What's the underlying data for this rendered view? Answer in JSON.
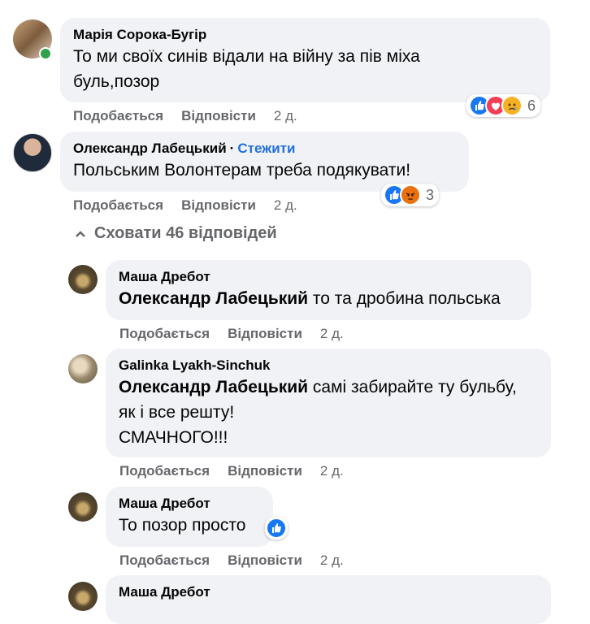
{
  "comments": [
    {
      "author": "Марія Сорока-Бугір",
      "lines": [
        "То ми своїх синів відали на війну за пів міха",
        "буль,позор"
      ],
      "actions": {
        "like": "Подобається",
        "reply": "Відповісти",
        "time": "2 д."
      },
      "reaction_count": "6",
      "reactions": [
        "like-icon",
        "love-icon",
        "sad-icon"
      ]
    },
    {
      "author": "Олександр Лабецький",
      "follow": "Стежити",
      "lines": [
        "Польським Волонтерам треба подякувати!"
      ],
      "actions": {
        "like": "Подобається",
        "reply": "Відповісти",
        "time": "2 д."
      },
      "reaction_count": "3",
      "reactions": [
        "like-icon",
        "angry-icon"
      ]
    }
  ],
  "toggle_label": "Сховати 46 відповідей",
  "replies": [
    {
      "author": "Маша Дребот",
      "mention": "Олександр Лабецький",
      "lines": [
        " то та дробина польська"
      ],
      "actions": {
        "like": "Подобається",
        "reply": "Відповісти",
        "time": "2 д."
      }
    },
    {
      "author": "Galinka Lyakh-Sinchuk",
      "mention": "Олександр Лабецький",
      "lines": [
        " самі забирайте ту бульбу,",
        "як і все решту!",
        "СМАЧНОГО!!!"
      ],
      "actions": {
        "like": "Подобається",
        "reply": "Відповісти",
        "time": "2 д."
      }
    },
    {
      "author": "Маша Дребот",
      "lines": [
        "То позор просто"
      ],
      "actions": {
        "like": "Подобається",
        "reply": "Відповісти",
        "time": "2 д."
      },
      "reactions": [
        "like-icon"
      ]
    },
    {
      "author": "Маша Дребот"
    }
  ],
  "colors": {
    "bubble": "#f0f2f5",
    "muted": "#65676b",
    "link": "#216fdb",
    "like": "#1877f2",
    "online": "#31a24c"
  }
}
